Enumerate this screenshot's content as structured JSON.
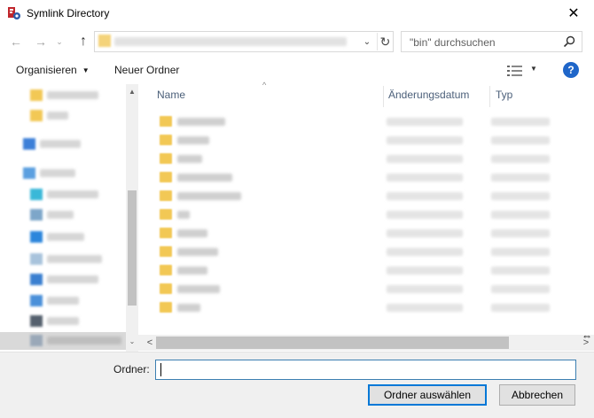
{
  "window": {
    "title": "Symlink Directory",
    "close_glyph": "✕",
    "app_icon": "symlink-app-icon"
  },
  "address": {
    "back_glyph": "←",
    "forward_glyph": "→",
    "history_glyph": "⌄",
    "up_glyph": "↑",
    "dropdown_glyph": "⌄",
    "refresh_glyph": "↻",
    "search_placeholder": "\"bin\" durchsuchen"
  },
  "toolbar": {
    "organize_label": "Organisieren",
    "organize_caret": "▼",
    "new_folder_label": "Neuer Ordner",
    "help_label": "?",
    "view_caret": "▼"
  },
  "file_list": {
    "sort_glyph": "^",
    "columns": {
      "name": "Name",
      "date": "Änderungsdatum",
      "type": "Typ"
    },
    "row_count": 11
  },
  "nav_pane": {
    "scroll_up_glyph": "▲",
    "scroll_down_glyph": "⌄",
    "scroll_left_glyph": "<"
  },
  "scrollbar": {
    "left_glyph": "<",
    "right_glyph": ">"
  },
  "footer": {
    "folder_label": "Ordner:",
    "folder_value": "",
    "select_button": "Ordner auswählen",
    "cancel_button": "Abbrechen"
  },
  "colors": {
    "accent": "#0078d7",
    "folder": "#f2c855",
    "help": "#1f66c9",
    "header_text": "#4c607a"
  }
}
